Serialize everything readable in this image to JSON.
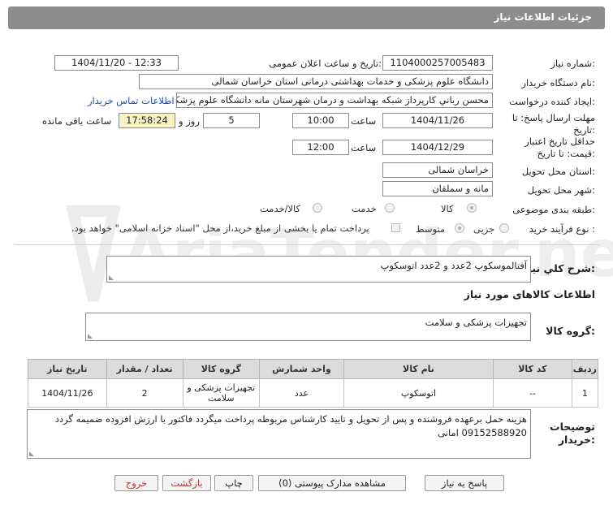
{
  "page_title": "جزئیات اطلاعات نیاز",
  "fields": {
    "need_number_label": "شماره نیاز:",
    "need_number": "1104000257005483",
    "announce_label": "تاریخ و ساعت اعلان عمومی:",
    "announce_value": "1404/11/20 - 12:33",
    "buyer_org_label": "نام دستگاه خریدار:",
    "buyer_org": "دانشگاه علوم پزشکی و خدمات بهداشتی درمانی استان خراسان شمالی",
    "creator_label": "ایجاد کننده درخواست:",
    "creator": "محسن رباني كارپرداز شبكه بهداشت و درمان شهرستان مانه دانشگاه علوم پزشکی",
    "contact_link": "اطلاعات تماس خریدار",
    "reply_deadline_label_1": "مهلت ارسال پاسخ: تا",
    "reply_deadline_label_2": "تاریخ:",
    "reply_date": "1404/11/26",
    "time_label": "ساعت",
    "reply_time": "10:00",
    "days_count": "5",
    "days_label": "روز و",
    "remaining_time": "17:58:24",
    "remaining_label": "ساعت باقی مانده",
    "validity_label_1": "حداقل تاریخ اعتبار",
    "validity_label_2": "قیمت: تا تاریخ:",
    "validity_date": "1404/12/29",
    "validity_time": "12:00",
    "province_label": "استان محل تحویل:",
    "province": "خراسان شمالی",
    "city_label": "شهر محل تحویل:",
    "city": "مانه و سملقان",
    "category_label": "طبقه بندی موضوعی:",
    "category_options": [
      "کالا",
      "خدمت",
      "کالا/خدمت"
    ],
    "process_label": "نوع فرآیند خرید :",
    "process_options": [
      "جزیی",
      "متوسط"
    ],
    "payment_note": "پرداخت تمام یا بخشی از مبلغ خرید،از محل \"اسناد خزانه اسلامی\" خواهد بود."
  },
  "summary": {
    "label": "شرح كلي نياز:",
    "text": "آفتالموسکوپ 2عدد  و 2عدد اتوسکوپ"
  },
  "goods_info_title": "اطلاعات کالاهای مورد نیاز",
  "goods_group": {
    "label": "گروه کالا:",
    "text": "تجهیزات پزشکی و سلامت"
  },
  "table": {
    "headers": [
      "ردیف",
      "کد کالا",
      "نام کالا",
      "واحد شمارش",
      "گروه کالا",
      "تعداد / مقدار",
      "تاریخ نیاز"
    ],
    "rows": [
      [
        "1",
        "--",
        "اتوسکوپ",
        "عدد",
        "تجهیزات پزشکی و سلامت",
        "2",
        "1404/11/26"
      ]
    ]
  },
  "buyer_notes": {
    "label_1": "توضیحات",
    "label_2": "خریدار:",
    "text": "هزینه حمل برعهده فروشنده و پس از تحویل و تایید کارشناس مربوطه پرداخت میگردد فاکتور با ارزش افزوده ضمیمه گردد 09152588920 امانی"
  },
  "buttons": {
    "reply": "پاسخ به نیاز",
    "attachments": "مشاهده مدارک پیوستی (0)",
    "print": "چاپ",
    "back": "بازگشت",
    "exit": "خروج"
  },
  "watermark": "AriaTender.net",
  "colors": {
    "title_bar": "#8d8d8d",
    "link": "#1a4fb0",
    "highlight": "#f8f2c4",
    "table_header": "#dcdcdc",
    "watermark": "#e9e9e9"
  }
}
